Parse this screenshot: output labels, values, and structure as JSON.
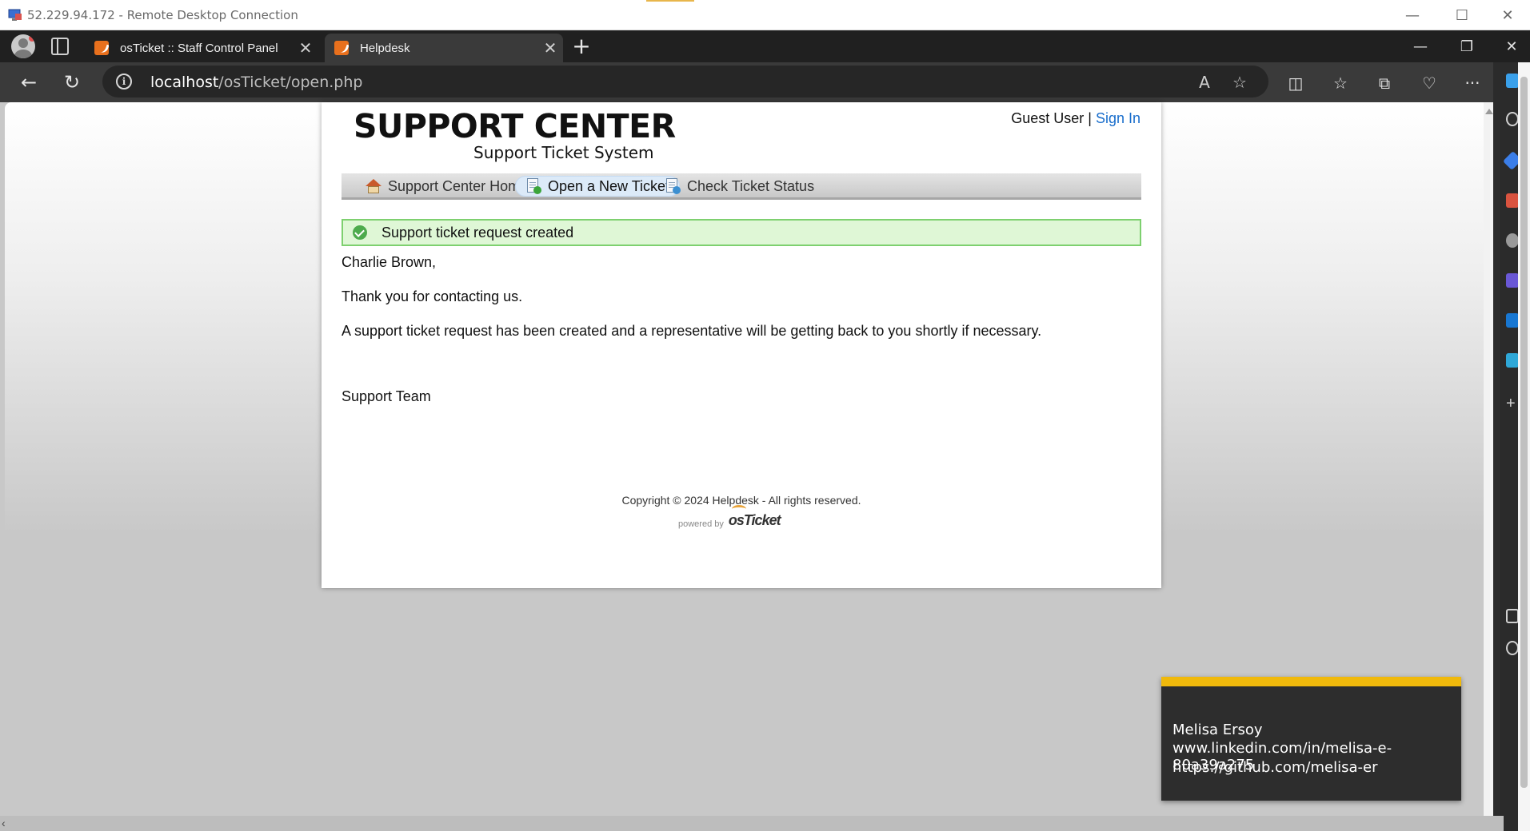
{
  "rdp": {
    "title": "52.229.94.172 - Remote Desktop Connection",
    "minimize": "—",
    "maximize": "☐",
    "close": "✕"
  },
  "browser": {
    "tabs": [
      {
        "label": "osTicket :: Staff Control Panel",
        "close": "✕"
      },
      {
        "label": "Helpdesk",
        "close": "✕"
      }
    ],
    "new_tab": "+",
    "url_host": "localhost",
    "url_path": "/osTicket/open.php",
    "window_minimize": "—",
    "window_restore": "❐",
    "window_close": "✕",
    "back": "←",
    "refresh": "↻",
    "read_aloud": "A",
    "favorite": "☆",
    "split": "◫",
    "favorites": "☆",
    "collections": "⧉",
    "health": "♡",
    "more": "···"
  },
  "site": {
    "logo_title": "SUPPORT CENTER",
    "logo_subtitle": "Support Ticket System",
    "guest_user": "Guest User",
    "separator": " | ",
    "sign_in": "Sign In",
    "nav": [
      {
        "label": "Support Center Home",
        "icon": "home-icon"
      },
      {
        "label": "Open a New Ticket",
        "icon": "new-ticket-icon"
      },
      {
        "label": "Check Ticket Status",
        "icon": "ticket-status-icon"
      }
    ],
    "alert": "Support ticket request created",
    "greeting": "Charlie Brown,",
    "thanks": "Thank you for contacting us.",
    "body": "A support ticket request has been created and a representative will be getting back to you shortly if necessary.",
    "signoff": "Support Team",
    "copyright": "Copyright © 2024 Helpdesk - All rights reserved.",
    "powered_by": "powered by",
    "brand": "osTicket"
  },
  "watermark": {
    "name": "Melisa Ersoy",
    "linkedin": "www.linkedin.com/in/melisa-e-80a39a275",
    "github": "https://github.com/melisa-er"
  },
  "colors": {
    "accent_link": "#1a6ecc",
    "success_bg": "#dff7d6",
    "success_border": "#7ed06f",
    "watermark_accent": "#f0b90b"
  }
}
